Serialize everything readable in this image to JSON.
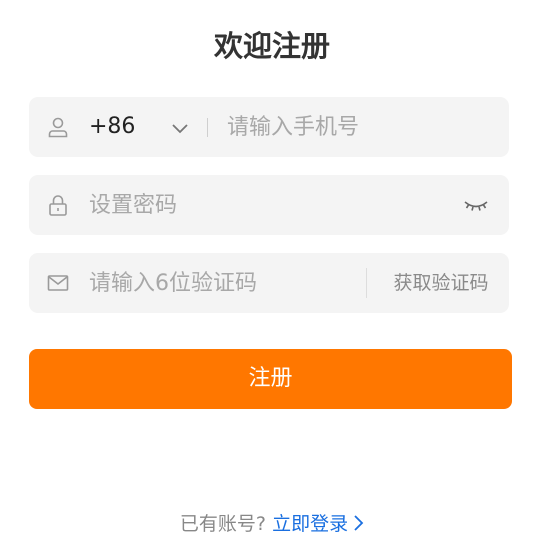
{
  "title": "欢迎注册",
  "phone_field": {
    "icon": "user-icon",
    "country_code": "+86",
    "dropdown_icon": "chevron-down-icon",
    "placeholder": "请输入手机号",
    "value": ""
  },
  "password_field": {
    "icon": "lock-icon",
    "placeholder": "设置密码",
    "value": "",
    "toggle_icon": "eye-closed-icon"
  },
  "code_field": {
    "icon": "envelope-icon",
    "placeholder": "请输入6位验证码",
    "value": "",
    "get_code_label": "获取验证码"
  },
  "submit": {
    "label": "注册",
    "color": "#ff7700"
  },
  "footer": {
    "prompt": "已有账号?",
    "login_link": "立即登录",
    "link_icon": "chevron-right-icon",
    "link_color": "#1a6fe0"
  }
}
